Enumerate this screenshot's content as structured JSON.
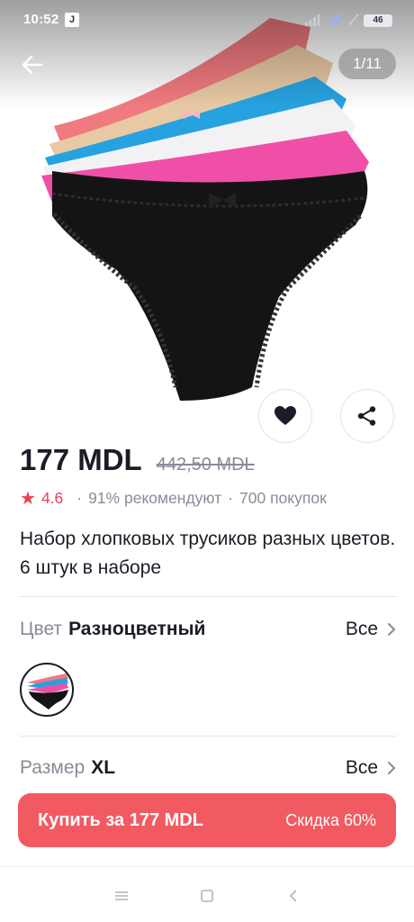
{
  "status_bar": {
    "time": "10:52",
    "app_badge": "J",
    "battery": "46"
  },
  "gallery": {
    "counter": "1/11"
  },
  "product": {
    "price": "177 MDL",
    "old_price": "442,50 MDL",
    "rating": "4.6",
    "recommend": "91% рекомендуют",
    "purchases": "700 покупок",
    "title": "Набор хлопковых трусиков разных цветов. 6 штук в наборе"
  },
  "color_option": {
    "key": "Цвет",
    "value": "Разноцветный",
    "all": "Все"
  },
  "size_option": {
    "key": "Размер",
    "value": "XL",
    "all": "Все"
  },
  "buy_button": {
    "label": "Купить за 177 MDL",
    "discount": "Скидка 60%"
  },
  "colors": {
    "accent": "#f25a62",
    "rating": "#e8424f",
    "text": "#1c1c28",
    "muted": "#8a8a99"
  },
  "icons": {
    "back": "arrow-left-icon",
    "favorite": "heart-icon",
    "share": "share-icon",
    "chevron": "chevron-right-icon",
    "star": "star-icon",
    "nav_menu": "menu-icon",
    "nav_home": "square-icon",
    "nav_back": "triangle-back-icon"
  }
}
